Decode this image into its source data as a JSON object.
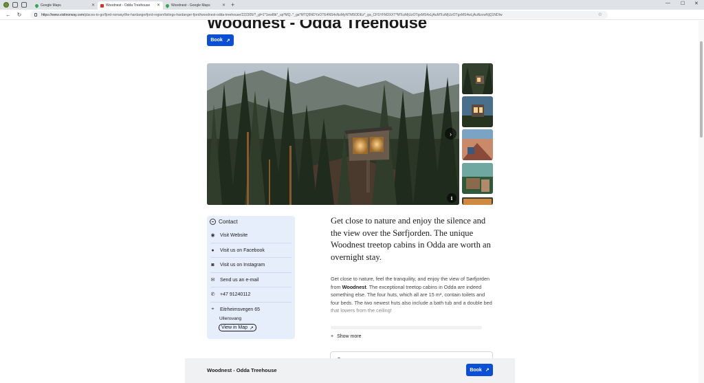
{
  "browser": {
    "tabs": [
      {
        "title": "Google Maps",
        "active": false
      },
      {
        "title": "Woodnest - Odda Treehouse",
        "active": true
      },
      {
        "title": "Woodnest - Google Maps",
        "active": false
      }
    ],
    "url_domain": "https://www.visitnorway.com",
    "url_path": "/places-to-go/fjord-norway/the-hardangerfjord-region/listings-hardanger-fjord/woodnest-odda-treehouse/222305/?_gl=1*1ew8lk*_up*MQ..*_ga*MTQ5NDYzOTE4NS4xNzMyNTM5ODEz*_ga_CFSYFM3XXT*MTczMjUzOTgxMS4xLjAuMTczMjUzOTgxMS4wLjAuNzcwNjQ1NDIw"
  },
  "page": {
    "title": "Woodnest - Odda Treehouse",
    "book_label": "Book",
    "contact": {
      "heading": "Contact",
      "website": "Visit Website",
      "facebook": "Visit us on Facebook",
      "instagram": "Visit us on Instagram",
      "email": "Send us an e-mail",
      "phone": "+47 91240112",
      "address_line1": "Eitrheimsvegen 65",
      "address_line2": "Ullensvang",
      "map_link": "View in Map"
    },
    "lead": "Get close to nature and enjoy the silence and the view over the Sørfjorden. The unique Woodnest treetop cabins in Odda are worth an overnight stay.",
    "body_pre": "Get close to nature, feel the tranquility, and enjoy the view of Sørfjorden from ",
    "body_bold": "Woodnest",
    "body_post": ". The exceptional treetop cabins in Odda are indeed something else. The four huts, which all are 15 m², contain toilets and four beds. The two newest huts also include a bath tub and a double bed that lowers from the ceiling!",
    "show_more": "Show more",
    "sticky_title": "Woodnest - Odda Treehouse"
  },
  "colors": {
    "accent": "#0a4fd6",
    "contact_bg": "#e6edfb"
  }
}
